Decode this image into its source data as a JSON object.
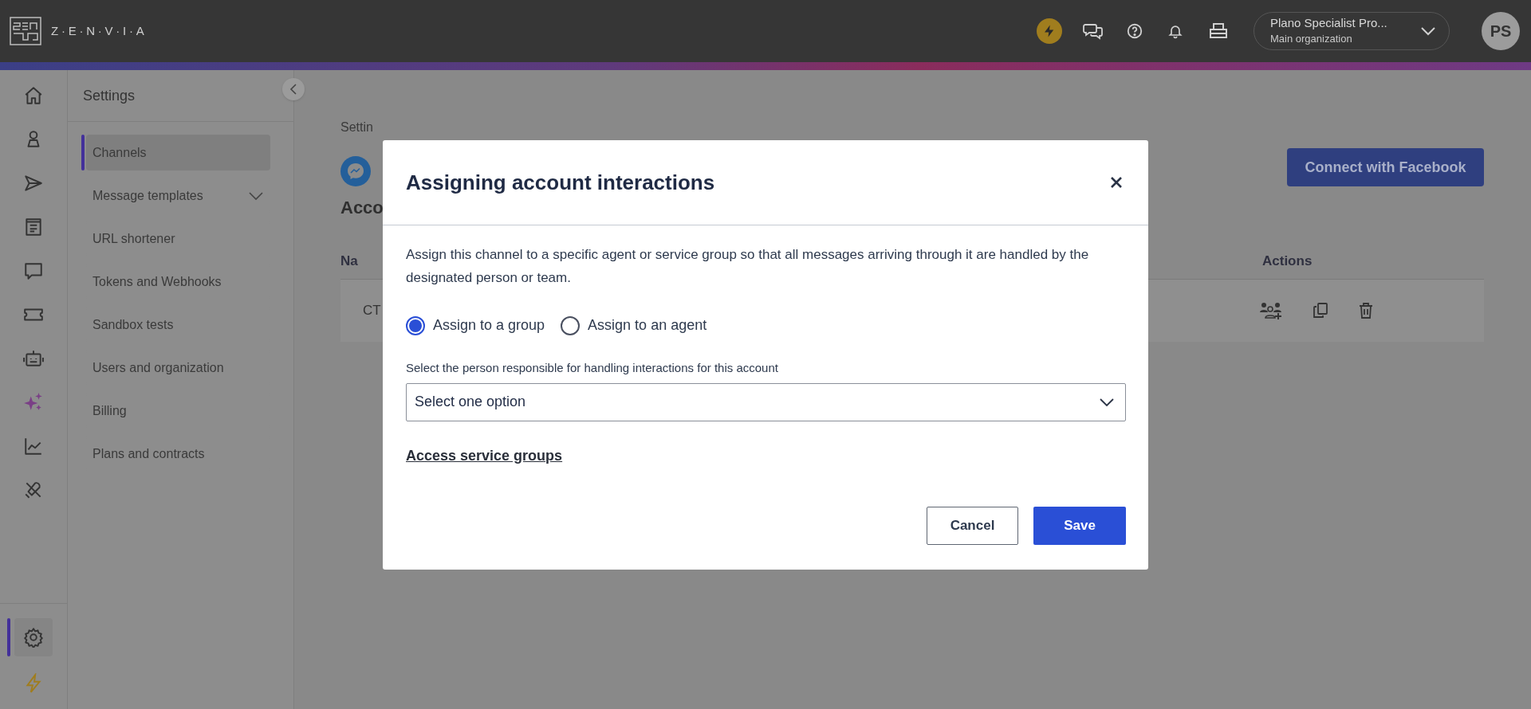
{
  "topbar": {
    "brand": "Z·E·N·V·I·A",
    "org": {
      "name": "Plano Specialist Pro...",
      "subtitle": "Main organization"
    },
    "avatar": "PS"
  },
  "rail": {
    "bottom_items": [
      {
        "selected": true
      },
      {
        "selected": false
      }
    ]
  },
  "settings_menu": {
    "title": "Settings",
    "items": [
      {
        "label": "Channels",
        "selected": true
      },
      {
        "label": "Message templates",
        "selected": false,
        "expanded": false
      },
      {
        "label": "URL shortener",
        "selected": false
      },
      {
        "label": "Tokens and Webhooks",
        "selected": false
      },
      {
        "label": "Sandbox tests",
        "selected": false
      },
      {
        "label": "Users and organization",
        "selected": false
      },
      {
        "label": "Billing",
        "selected": false
      },
      {
        "label": "Plans and contracts",
        "selected": false
      }
    ]
  },
  "page": {
    "breadcrumb": "Settin",
    "section_heading": "Acco",
    "connect_button": "Connect with Facebook",
    "table": {
      "columns": [
        "Na",
        "Actions"
      ],
      "rows": [
        {
          "cells": [
            "CT"
          ]
        }
      ]
    }
  },
  "modal": {
    "title": "Assigning account interactions",
    "description": "Assign this channel to a specific agent or service group so that all messages arriving through it are handled by the designated person or team.",
    "options": [
      {
        "label": "Assign to a group",
        "selected": true
      },
      {
        "label": "Assign to an agent",
        "selected": false
      }
    ],
    "select": {
      "label": "Select the person responsible for handling interactions for this account",
      "placeholder": "Select one option"
    },
    "link": "Access service groups",
    "buttons": {
      "cancel": "Cancel",
      "save": "Save"
    }
  }
}
